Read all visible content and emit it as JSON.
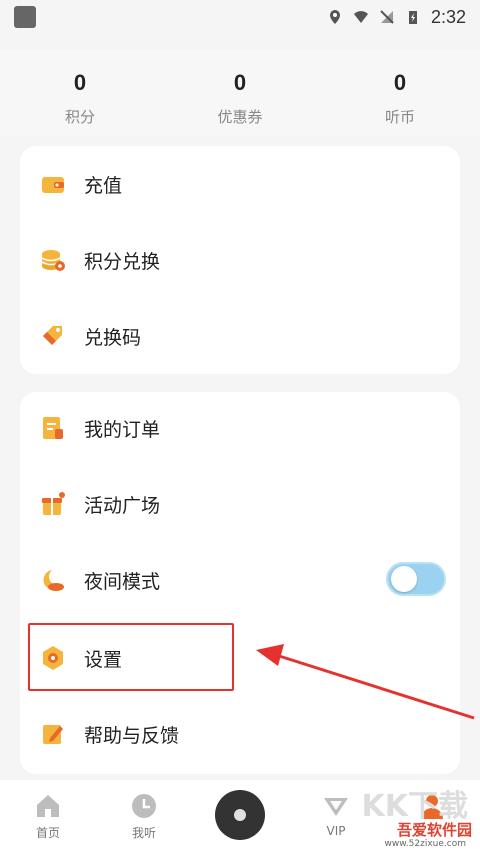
{
  "status_bar": {
    "time": "2:32"
  },
  "stats": [
    {
      "value": "0",
      "label": "积分"
    },
    {
      "value": "0",
      "label": "优惠券"
    },
    {
      "value": "0",
      "label": "听币"
    }
  ],
  "menu_group1": [
    {
      "label": "充值",
      "icon": "wallet-icon"
    },
    {
      "label": "积分兑换",
      "icon": "coins-icon"
    },
    {
      "label": "兑换码",
      "icon": "tag-icon"
    }
  ],
  "menu_group2": [
    {
      "label": "我的订单",
      "icon": "order-icon"
    },
    {
      "label": "活动广场",
      "icon": "gift-icon"
    },
    {
      "label": "夜间模式",
      "icon": "moon-icon"
    },
    {
      "label": "设置",
      "icon": "settings-icon"
    },
    {
      "label": "帮助与反馈",
      "icon": "feedback-icon"
    }
  ],
  "night_mode": {
    "enabled": false
  },
  "tabbar": [
    {
      "label": "首页",
      "icon": "home-icon"
    },
    {
      "label": "我听",
      "icon": "clock-icon"
    },
    {
      "label": "",
      "icon": "play-disc-icon"
    },
    {
      "label": "VIP",
      "icon": "vip-icon"
    },
    {
      "label": "",
      "icon": "profile-icon"
    }
  ],
  "watermark": {
    "brand": "KK下载",
    "title": "吾爱软件园",
    "url": "www.52zixue.com"
  },
  "colors": {
    "accent": "#f5b53d",
    "accent_red": "#e5322e",
    "toggle_bg": "#9ad2ef"
  }
}
